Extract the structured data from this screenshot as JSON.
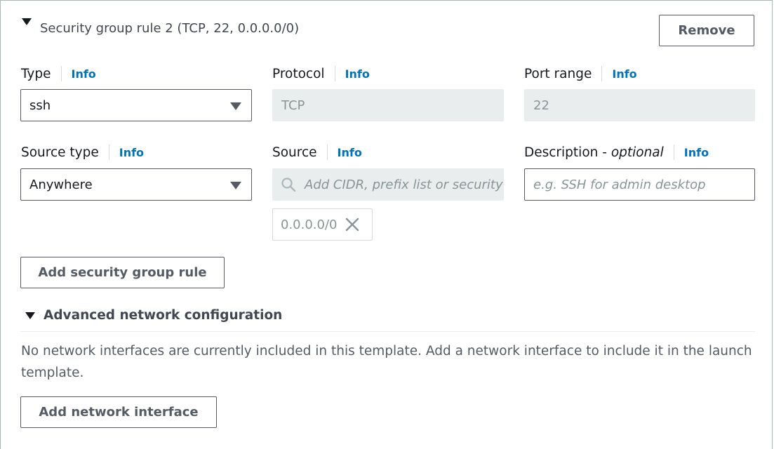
{
  "rule": {
    "title": "Security group rule 2 (TCP, 22, 0.0.0.0/0)",
    "remove_label": "Remove"
  },
  "fields": {
    "type": {
      "label": "Type",
      "info": "Info",
      "value": "ssh"
    },
    "protocol": {
      "label": "Protocol",
      "info": "Info",
      "value": "TCP"
    },
    "port_range": {
      "label": "Port range",
      "info": "Info",
      "value": "22"
    },
    "source_type": {
      "label": "Source type",
      "info": "Info",
      "value": "Anywhere"
    },
    "source": {
      "label": "Source",
      "info": "Info",
      "placeholder": "Add CIDR, prefix list or security group",
      "tokens": [
        "0.0.0.0/0"
      ]
    },
    "description": {
      "label": "Description",
      "label_suffix": " - ",
      "optional": "optional",
      "info": "Info",
      "placeholder": "e.g. SSH for admin desktop"
    }
  },
  "add_rule_label": "Add security group rule",
  "advanced": {
    "title": "Advanced network configuration",
    "message": "No network interfaces are currently included in this template. Add a network interface to include it in the launch template.",
    "add_interface_label": "Add network interface"
  },
  "icons": {
    "expand": "caret-down-icon",
    "dropdown": "caret-down-icon",
    "search": "search-icon",
    "remove_token": "close-icon"
  },
  "colors": {
    "link": "#0073bb",
    "border": "#545b64",
    "disabled_bg": "#eaeded",
    "text": "#16191f"
  }
}
